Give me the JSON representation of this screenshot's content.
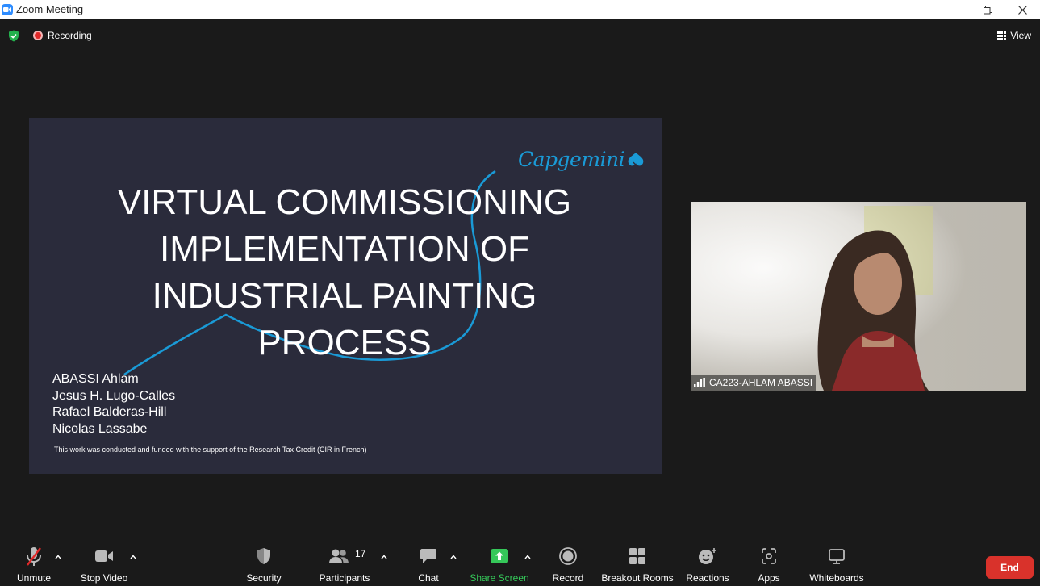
{
  "window": {
    "title": "Zoom Meeting"
  },
  "meeting": {
    "recording_label": "Recording",
    "view_label": "View"
  },
  "slide": {
    "logo": "Capgemini",
    "title": "VIRTUAL COMMISSIONING\nIMPLEMENTATION OF\nINDUSTRIAL PAINTING\nPROCESS",
    "authors": [
      "ABASSI Ahlam",
      "Jesus H. Lugo-Calles",
      "Rafael Balderas-Hill",
      "Nicolas Lassabe"
    ],
    "footnote": "This work was conducted and funded with the support of the Research Tax Credit (CIR in French)",
    "colors": {
      "background": "#2a2b3b",
      "accent": "#1a9ad6"
    }
  },
  "participant": {
    "name": "CA223-AHLAM ABASSI"
  },
  "toolbar": {
    "unmute": "Unmute",
    "stop_video": "Stop Video",
    "security": "Security",
    "participants": "Participants",
    "participants_count": "17",
    "chat": "Chat",
    "share_screen": "Share Screen",
    "record": "Record",
    "breakout_rooms": "Breakout Rooms",
    "reactions": "Reactions",
    "apps": "Apps",
    "whiteboards": "Whiteboards",
    "end": "End",
    "share_color": "#35c759",
    "end_color": "#d9322b"
  }
}
